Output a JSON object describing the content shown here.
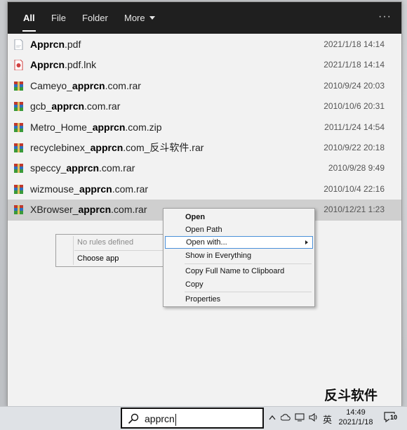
{
  "tabs": [
    "All",
    "File",
    "Folder",
    "More"
  ],
  "menu_more_icon": "ellipsis-icon",
  "results": [
    {
      "pre": "",
      "bold": "Apprcn",
      "post": ".pdf",
      "date": "2021/1/18 14:14",
      "icon": "pdf-icon"
    },
    {
      "pre": "",
      "bold": "Apprcn",
      "post": ".pdf.lnk",
      "date": "2021/1/18 14:14",
      "icon": "pdf-shortcut-icon"
    },
    {
      "pre": "Cameyo_",
      "bold": "apprcn",
      "post": ".com.rar",
      "date": "2010/9/24 20:03",
      "icon": "archive-icon"
    },
    {
      "pre": "gcb_",
      "bold": "apprcn",
      "post": ".com.rar",
      "date": "2010/10/6 20:31",
      "icon": "archive-icon"
    },
    {
      "pre": "Metro_Home_",
      "bold": "apprcn",
      "post": ".com.zip",
      "date": "2011/1/24 14:54",
      "icon": "archive-icon"
    },
    {
      "pre": "recyclebinex_",
      "bold": "apprcn",
      "post": ".com_反斗软件.rar",
      "date": "2010/9/22 20:18",
      "icon": "archive-icon"
    },
    {
      "pre": "speccy_",
      "bold": "apprcn",
      "post": ".com.rar",
      "date": "2010/9/28 9:49",
      "icon": "archive-icon"
    },
    {
      "pre": "wizmouse_",
      "bold": "apprcn",
      "post": ".com.rar",
      "date": "2010/10/4 22:16",
      "icon": "archive-icon"
    },
    {
      "pre": "XBrowser_",
      "bold": "apprcn",
      "post": ".com.rar",
      "date": "2010/12/21 1:23",
      "icon": "archive-icon",
      "selected": true
    }
  ],
  "context_menu": {
    "open": "Open",
    "open_path": "Open Path",
    "open_with": "Open with...",
    "show_in_everything": "Show in Everything",
    "copy_full_name": "Copy Full Name to Clipboard",
    "copy": "Copy",
    "properties": "Properties"
  },
  "submenu": {
    "no_rules": "No rules defined",
    "choose_app": "Choose app"
  },
  "watermark": "反斗软件",
  "taskbar": {
    "search_text": "apprcn",
    "ime": "英",
    "time": "14:49",
    "date": "2021/1/18",
    "notification_count": "10"
  },
  "colors": {
    "tabbar": "#1f1f1f",
    "selection": "#cfcfcf",
    "highlight_border": "#4a90d9"
  }
}
